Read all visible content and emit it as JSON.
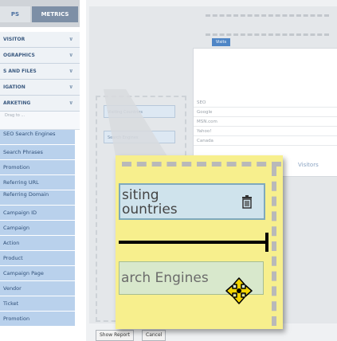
{
  "sidebar": {
    "tabs": [
      {
        "label": "PS"
      },
      {
        "label": "METRICS"
      }
    ],
    "sections": [
      {
        "label": "VISITOR"
      },
      {
        "label": "OGRAPHICS"
      },
      {
        "label": "S AND FILES"
      },
      {
        "label": "IGATION"
      },
      {
        "label": "ARKETING"
      }
    ],
    "drag_hint": "Drag to ...",
    "items": [
      {
        "label": "SEO Search Engines"
      },
      {
        "label": "Search Phrases"
      },
      {
        "label": "Promotion"
      },
      {
        "label": "Referring URL"
      },
      {
        "label": "Referring Domain"
      },
      {
        "label": "Campaign ID"
      },
      {
        "label": "Campaign"
      },
      {
        "label": "Action"
      },
      {
        "label": "Product"
      },
      {
        "label": "Campaign Page"
      },
      {
        "label": "Vendor"
      },
      {
        "label": "Ticket"
      },
      {
        "label": "Promotion"
      }
    ]
  },
  "workspace": {
    "report_header": "Visits",
    "report_rows": [
      "SEO",
      "Google",
      "MSN.com",
      "Yahoo!",
      "Canada"
    ],
    "chips": [
      "Visiting Countries",
      "Search Engines"
    ],
    "visitors_label": "Visitors",
    "buttons": {
      "show": "Show Report",
      "cancel": "Cancel"
    }
  },
  "magnifier": {
    "row1_label": "siting\nountries",
    "row2_label": "arch Engines"
  },
  "icons": {
    "trash": "trash-icon",
    "move_cursor": "move-cursor-icon"
  },
  "colors": {
    "accent": "#4f86c6",
    "magnifier_bg": "#f7ef8d",
    "item_bg": "#b9d1ec"
  }
}
